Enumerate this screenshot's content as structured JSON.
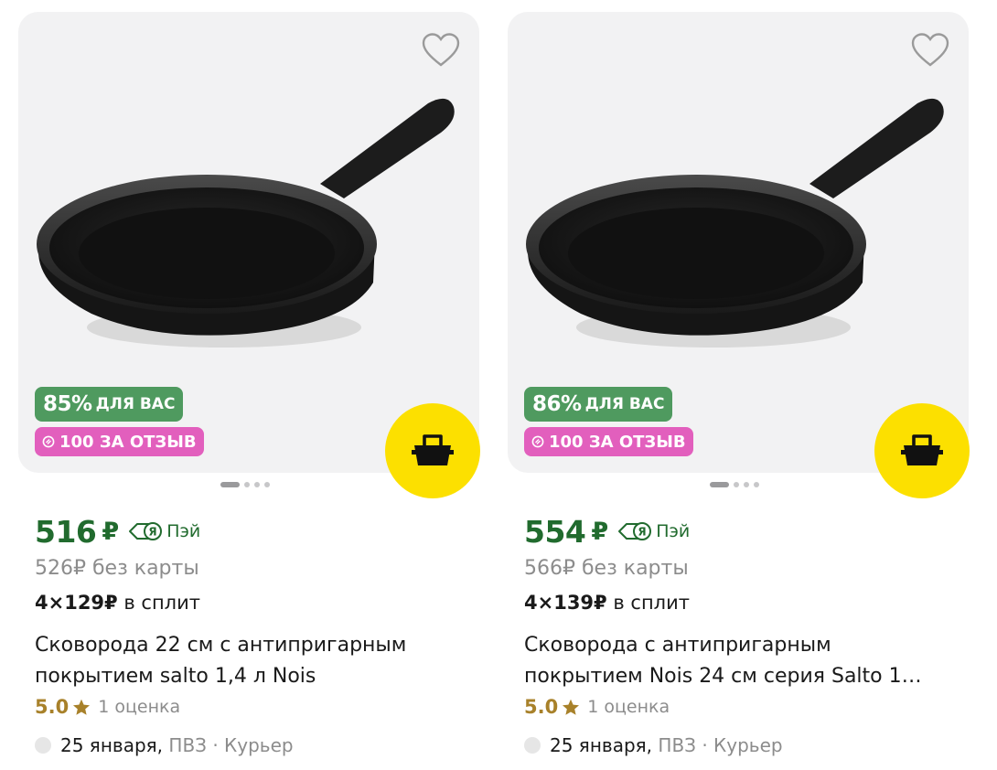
{
  "products": [
    {
      "discount_percent": "85%",
      "discount_label": "ДЛЯ ВАС",
      "review_bonus": "100 ЗА ОТЗЫВ",
      "price": "516",
      "currency": "₽",
      "pay_label": "Пэй",
      "old_price": "526₽ без карты",
      "split_amount": "4×129₽",
      "split_label": "в сплит",
      "title_line1": "Сковорода 22 см с антипригарным",
      "title_line2": "покрытием salto 1,4 л Nois",
      "rating": "5.0",
      "reviews_count": "1 оценка",
      "delivery_date": "25 января,",
      "delivery_modes": "ПВЗ · Курьер",
      "favorite_icon": "heart-outline-icon",
      "cart_icon": "basket-icon"
    },
    {
      "discount_percent": "86%",
      "discount_label": "ДЛЯ ВАС",
      "review_bonus": "100 ЗА ОТЗЫВ",
      "price": "554",
      "currency": "₽",
      "pay_label": "Пэй",
      "old_price": "566₽ без карты",
      "split_amount": "4×139₽",
      "split_label": "в сплит",
      "title_line1": "Сковорода с антипригарным",
      "title_line2": "покрытием Nois 24 см серия Salto 1…",
      "rating": "5.0",
      "reviews_count": "1 оценка",
      "delivery_date": "25 января,",
      "delivery_modes": "ПВЗ · Курьер",
      "favorite_icon": "heart-outline-icon",
      "cart_icon": "basket-icon"
    }
  ],
  "colors": {
    "price_green": "#216b2e",
    "discount_badge": "#4f9a5f",
    "review_badge": "#e25fbd",
    "cart_button": "#fce000",
    "rating_gold": "#a8812a"
  }
}
